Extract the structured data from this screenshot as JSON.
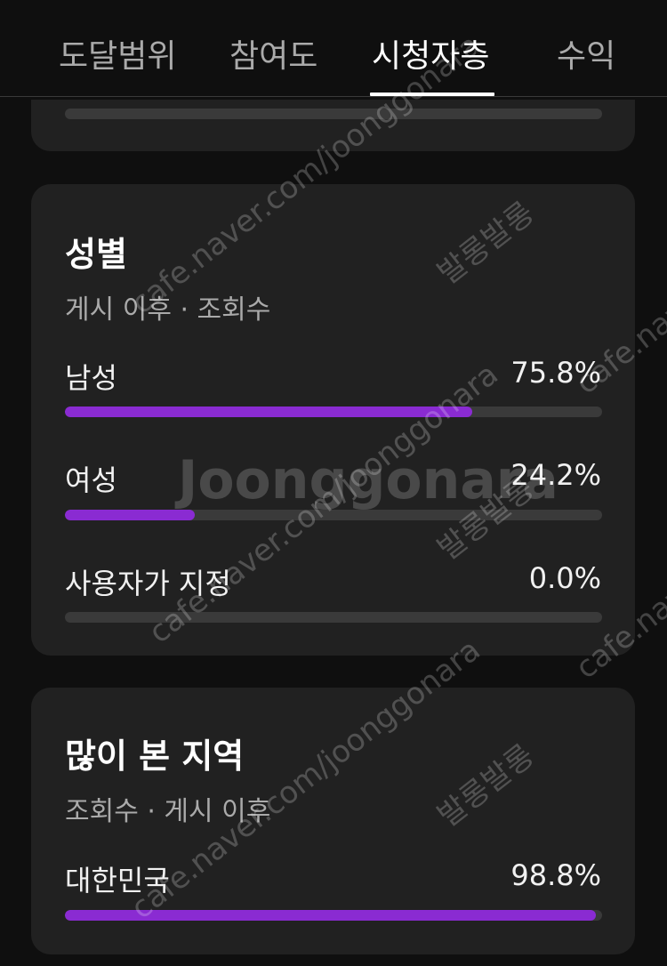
{
  "tabs": [
    {
      "label": "도달범위",
      "active": false
    },
    {
      "label": "참여도",
      "active": false
    },
    {
      "label": "시청자층",
      "active": true
    },
    {
      "label": "수익",
      "active": false
    }
  ],
  "gender_card": {
    "title": "성별",
    "subtitle": "게시 이후 · 조회수",
    "rows": [
      {
        "label": "남성",
        "value": "75.8%",
        "fraction": 0.758
      },
      {
        "label": "여성",
        "value": "24.2%",
        "fraction": 0.242
      },
      {
        "label": "사용자가 지정",
        "value": "0.0%",
        "fraction": 0.0
      }
    ]
  },
  "region_card": {
    "title": "많이 본 지역",
    "subtitle": "조회수 · 게시 이후",
    "rows": [
      {
        "label": "대한민국",
        "value": "98.8%",
        "fraction": 0.988
      }
    ]
  },
  "watermarks": {
    "brand": "Joonggonara",
    "url": "cafe.naver.com/joonggonara",
    "tag": "발롱발롱"
  },
  "colors": {
    "accent": "#8a2bd2",
    "track": "#3a3a3a",
    "card": "#212121",
    "background": "#0f0f0f"
  }
}
